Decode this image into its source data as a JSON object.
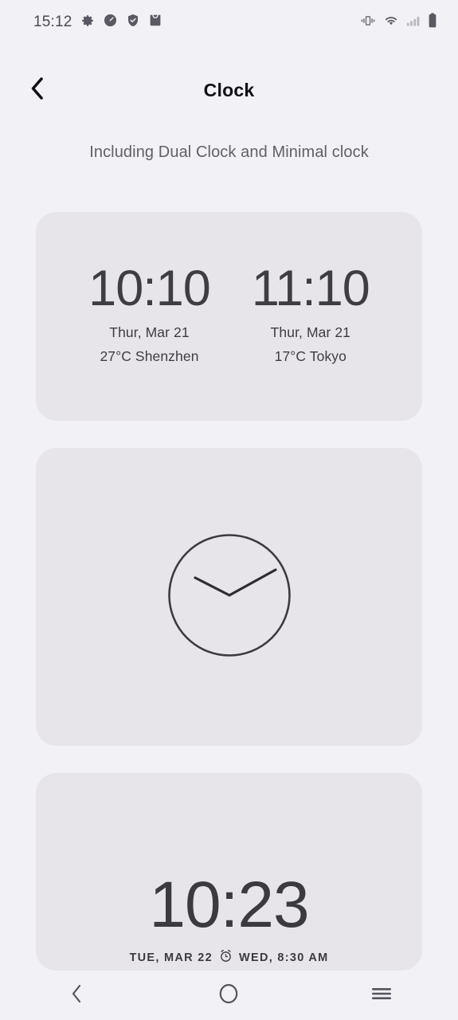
{
  "status_bar": {
    "time": "15:12",
    "left_icons": [
      "gear-icon",
      "speedometer-icon",
      "shield-check-icon",
      "bag-icon"
    ],
    "right_icons": [
      "vibrate-icon",
      "wifi-icon",
      "signal-bars-icon",
      "battery-icon"
    ]
  },
  "header": {
    "back_icon": "chevron-left-icon",
    "title": "Clock"
  },
  "subtitle": "Including Dual Clock and Minimal clock",
  "widgets": {
    "dual_clock": {
      "left": {
        "time": "10:10",
        "date": "Thur,  Mar 21",
        "weather": "27°C  Shenzhen"
      },
      "right": {
        "time": "11:10",
        "date": "Thur,  Mar 21",
        "weather": "17°C  Tokyo"
      }
    },
    "analog_clock": {
      "icon": "analog-clock-face",
      "hour_angle_deg": -61,
      "minute_angle_deg": 64
    },
    "minimal_clock": {
      "time": "10:23",
      "date": "TUE, MAR 22",
      "alarm_icon": "alarm-clock-icon",
      "alarm": "WED, 8:30 AM"
    }
  },
  "nav_bar": {
    "back": "chevron-left-icon",
    "home": "circle-icon",
    "recents": "hamburger-icon"
  },
  "colors": {
    "page_bg": "#f2f1f5",
    "card_bg": "#e7e5ea",
    "text_primary": "#3e3d43",
    "text_title": "#111015",
    "text_muted": "#616067"
  }
}
